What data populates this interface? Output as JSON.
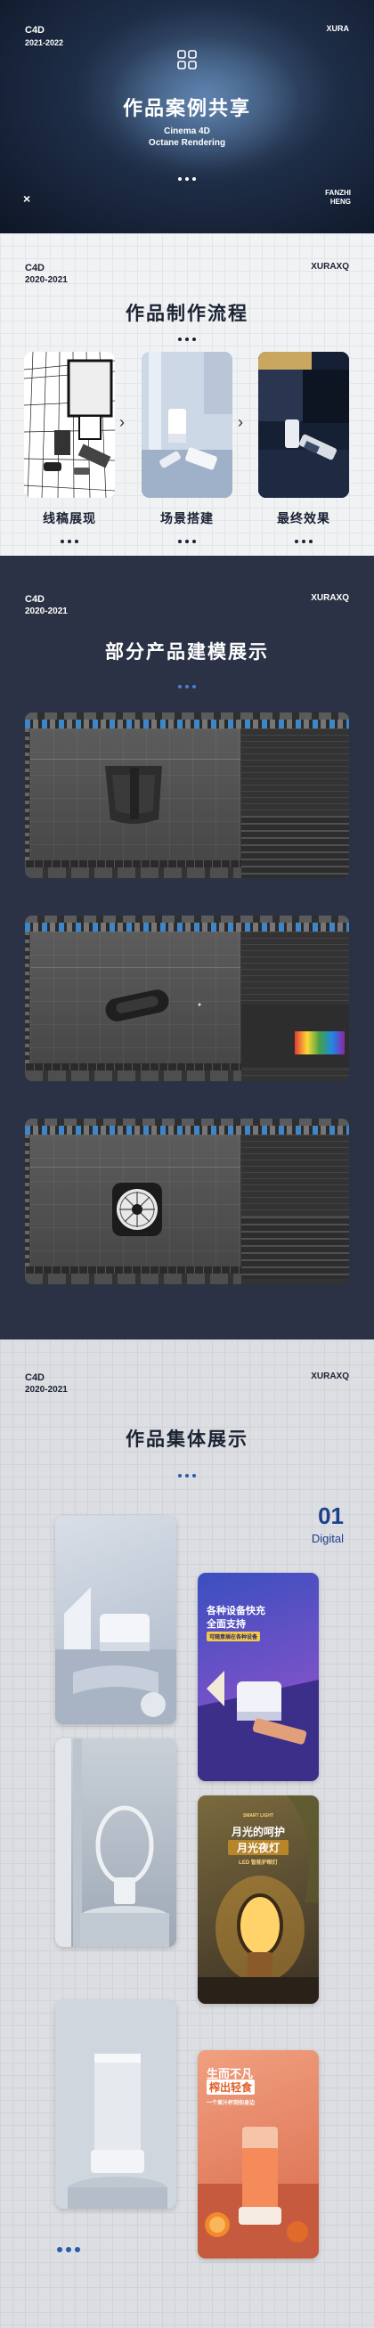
{
  "hero": {
    "brand": "C4D",
    "years": "2021-2022",
    "top_right": "XURA",
    "title": "作品案例共享",
    "subtitle_line1": "Cinema 4D",
    "subtitle_line2": "Octane Rendering",
    "close": "×",
    "author_line1": "FANZHI",
    "author_line2": "HENG"
  },
  "workflow": {
    "brand": "C4D",
    "years": "2020-2021",
    "right": "XURAXQ",
    "title": "作品制作流程",
    "steps": [
      {
        "label": "线稿展现"
      },
      {
        "label": "场景搭建"
      },
      {
        "label": "最终效果"
      }
    ],
    "arrow": "›"
  },
  "models": {
    "brand": "C4D",
    "years": "2020-2021",
    "right": "XURAXQ",
    "title": "部分产品建模展示",
    "screens": [
      "bag-model",
      "speaker-model",
      "fan-model"
    ]
  },
  "gallery": {
    "brand": "C4D",
    "years": "2020-2021",
    "right": "XURAXQ",
    "title": "作品集体展示",
    "number": "01",
    "number_label": "Digital",
    "poster1": {
      "line1": "各种设备快充",
      "line2": "全面支持",
      "tag": "可随意插在各种设备"
    },
    "poster2": {
      "top": "SMART LIGHT",
      "line1": "月光的呵护",
      "line2": "月光夜灯",
      "tag": "LED 智能护眼灯"
    },
    "poster3": {
      "line1": "生而不凡",
      "line2": "榨出轻食",
      "tag": "一个果汁杯到你身边"
    }
  },
  "colors": {
    "hero_bg": "#1e2d47",
    "models_bg": "#2b3245",
    "accent_blue": "#1d3f8a",
    "dot_blue": "#4c7fd4"
  }
}
